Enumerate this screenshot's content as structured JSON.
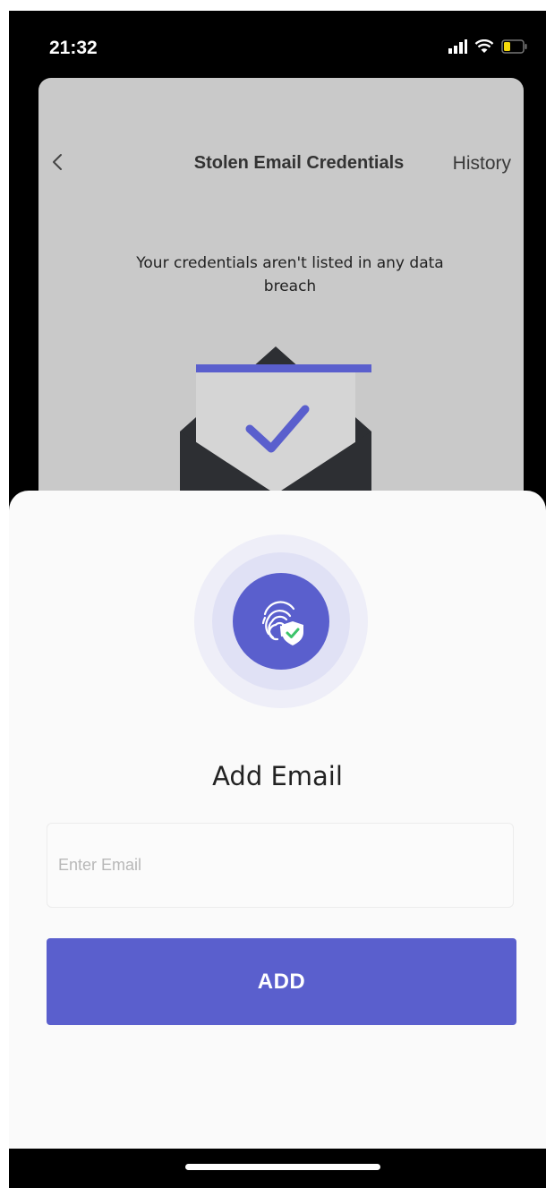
{
  "status_bar": {
    "time": "21:32",
    "icons": [
      "signal-icon",
      "wifi-icon",
      "battery-icon"
    ]
  },
  "background_screen": {
    "title": "Stolen Email Credentials",
    "history_label": "History",
    "message": "Your credentials aren't listed in any data breach"
  },
  "sheet": {
    "title": "Add Email",
    "email_placeholder": "Enter Email",
    "email_value": "",
    "add_label": "ADD"
  },
  "colors": {
    "accent": "#5a5fcd",
    "card_background": "#c9c9c9",
    "check_green": "#3cc46a"
  }
}
